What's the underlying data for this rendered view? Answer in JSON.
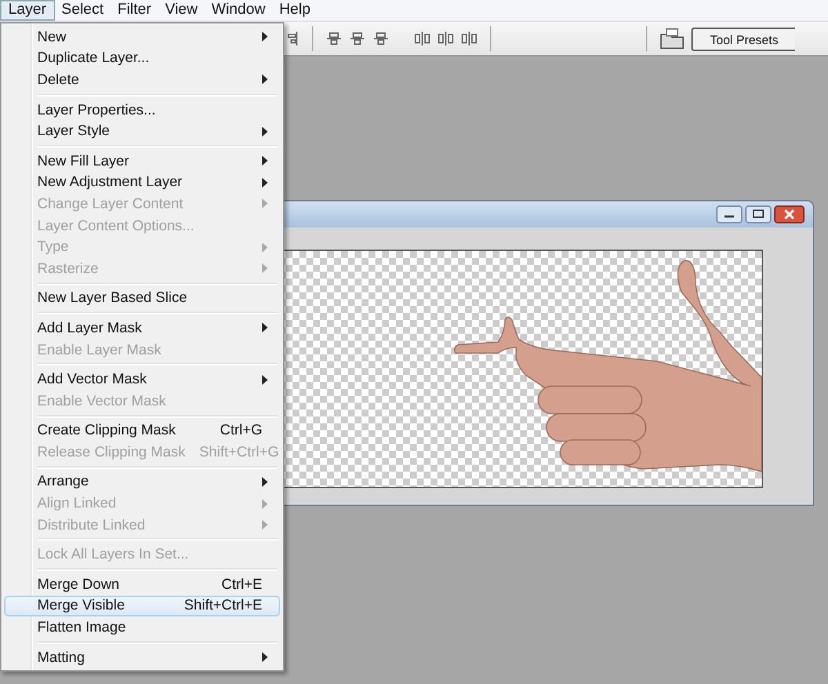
{
  "menubar": [
    {
      "label": "Layer",
      "selected": true
    },
    {
      "label": "Select",
      "selected": false
    },
    {
      "label": "Filter",
      "selected": false
    },
    {
      "label": "View",
      "selected": false
    },
    {
      "label": "Window",
      "selected": false
    },
    {
      "label": "Help",
      "selected": false
    }
  ],
  "toolbar": {
    "panel_tab": "Tool Presets"
  },
  "menu": {
    "groups": [
      [
        {
          "label": "New",
          "submenu": true,
          "disabled": false,
          "selected": false
        },
        {
          "label": "Duplicate Layer...",
          "submenu": false,
          "disabled": false,
          "selected": false
        },
        {
          "label": "Delete",
          "submenu": true,
          "disabled": false,
          "selected": false
        }
      ],
      [
        {
          "label": "Layer Properties...",
          "submenu": false,
          "disabled": false,
          "selected": false
        },
        {
          "label": "Layer Style",
          "submenu": true,
          "disabled": false,
          "selected": false
        }
      ],
      [
        {
          "label": "New Fill Layer",
          "submenu": true,
          "disabled": false,
          "selected": false
        },
        {
          "label": "New Adjustment Layer",
          "submenu": true,
          "disabled": false,
          "selected": false
        },
        {
          "label": "Change Layer Content",
          "submenu": true,
          "disabled": true,
          "selected": false
        },
        {
          "label": "Layer Content Options...",
          "submenu": false,
          "disabled": true,
          "selected": false
        },
        {
          "label": "Type",
          "submenu": true,
          "disabled": true,
          "selected": false
        },
        {
          "label": "Rasterize",
          "submenu": true,
          "disabled": true,
          "selected": false
        }
      ],
      [
        {
          "label": "New Layer Based Slice",
          "submenu": false,
          "disabled": false,
          "selected": false
        }
      ],
      [
        {
          "label": "Add Layer Mask",
          "submenu": true,
          "disabled": false,
          "selected": false
        },
        {
          "label": "Enable Layer Mask",
          "submenu": false,
          "disabled": true,
          "selected": false
        }
      ],
      [
        {
          "label": "Add Vector Mask",
          "submenu": true,
          "disabled": false,
          "selected": false
        },
        {
          "label": "Enable Vector Mask",
          "submenu": false,
          "disabled": true,
          "selected": false
        }
      ],
      [
        {
          "label": "Create Clipping Mask",
          "shortcut": "Ctrl+G",
          "submenu": false,
          "disabled": false,
          "selected": false
        },
        {
          "label": "Release Clipping Mask",
          "shortcut": "Shift+Ctrl+G",
          "submenu": false,
          "disabled": true,
          "selected": false
        }
      ],
      [
        {
          "label": "Arrange",
          "submenu": true,
          "disabled": false,
          "selected": false
        },
        {
          "label": "Align Linked",
          "submenu": true,
          "disabled": true,
          "selected": false
        },
        {
          "label": "Distribute Linked",
          "submenu": true,
          "disabled": true,
          "selected": false
        }
      ],
      [
        {
          "label": "Lock All Layers In Set...",
          "submenu": false,
          "disabled": true,
          "selected": false
        }
      ],
      [
        {
          "label": "Merge Down",
          "shortcut": "Ctrl+E",
          "submenu": false,
          "disabled": false,
          "selected": false
        },
        {
          "label": "Merge Visible",
          "shortcut": "Shift+Ctrl+E",
          "submenu": false,
          "disabled": false,
          "selected": true
        },
        {
          "label": "Flatten Image",
          "submenu": false,
          "disabled": false,
          "selected": false
        }
      ],
      [
        {
          "label": "Matting",
          "submenu": true,
          "disabled": false,
          "selected": false
        }
      ]
    ]
  }
}
